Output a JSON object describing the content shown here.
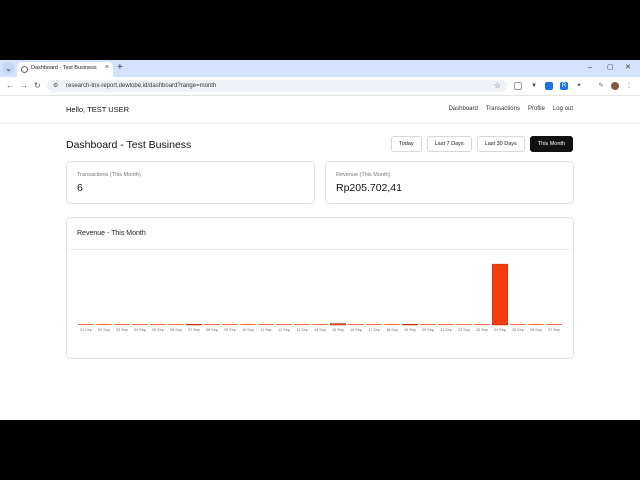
{
  "browser": {
    "tab_title": "Dashboard - Test Business",
    "url": "research-tnx-report.dewlobe.id/dashboard?range=month"
  },
  "navbar": {
    "greeting": "Hello, TEST USER",
    "links": [
      "Dashboard",
      "Transactions",
      "Profile",
      "Log out"
    ]
  },
  "page_title": "Dashboard - Test Business",
  "range_buttons": [
    "Today",
    "Last 7 Days",
    "Last 30 Days",
    "This Month"
  ],
  "active_range": "This Month",
  "cards": {
    "transactions": {
      "label": "Transactions (This Month)",
      "value": "6"
    },
    "revenue": {
      "label": "Revenue (This Month)",
      "value": "Rp205.702,41"
    }
  },
  "chart_title": "Revenue - This Month",
  "chart_data": {
    "type": "bar",
    "categories": [
      "01 Sep",
      "02 Sep",
      "03 Sep",
      "04 Sep",
      "05 Sep",
      "06 Sep",
      "07 Sep",
      "08 Sep",
      "09 Sep",
      "10 Sep",
      "11 Sep",
      "12 Sep",
      "13 Sep",
      "14 Sep",
      "15 Sep",
      "16 Sep",
      "17 Sep",
      "18 Sep",
      "19 Sep",
      "20 Sep",
      "21 Sep",
      "22 Sep",
      "23 Sep",
      "24 Sep",
      "25 Sep",
      "26 Sep",
      "27 Sep"
    ],
    "values": [
      0,
      0,
      0,
      0,
      0,
      0,
      1500,
      0,
      0,
      0,
      0,
      0,
      0,
      0,
      4500,
      0,
      0,
      0,
      2500,
      0,
      0,
      0,
      0,
      197202.41,
      0,
      0,
      0
    ],
    "ylim": [
      0,
      230000
    ],
    "grid": false,
    "legend": "none",
    "color": "#f53c0f"
  }
}
